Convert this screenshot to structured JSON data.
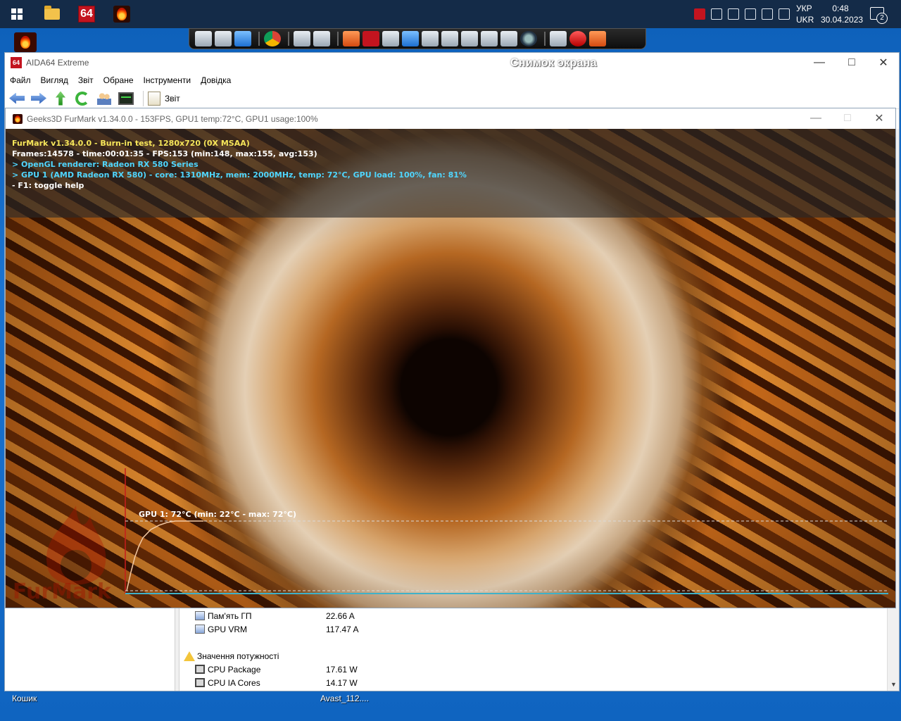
{
  "taskbar": {
    "lang_short": "УКР",
    "lang_code": "UKR",
    "time": "0:48",
    "date": "30.04.2023",
    "notifications": "2",
    "aida_label": "64"
  },
  "desktop": {
    "icons": [
      {
        "label": "Кошик"
      },
      {
        "label": "Avast_112...."
      }
    ]
  },
  "aida": {
    "title": "AIDA64 Extreme",
    "snip_label": "Снимок экрана",
    "menu": [
      "Файл",
      "Вигляд",
      "Звіт",
      "Обране",
      "Інструменти",
      "Довідка"
    ],
    "toolbar_report": "Звіт",
    "rows": [
      {
        "name": "Пам'ять ГП",
        "value": "22.66 A"
      },
      {
        "name": "GPU VRM",
        "value": "117.47 A"
      },
      {
        "section": "Значення потужності"
      },
      {
        "name": "CPU Package",
        "value": "17.61 W"
      },
      {
        "name": "CPU IA Cores",
        "value": "14.17 W"
      }
    ]
  },
  "furmark": {
    "title": "Geeks3D FurMark v1.34.0.0 - 153FPS, GPU1 temp:72°C, GPU1 usage:100%",
    "hud": [
      "FurMark v1.34.0.0 - Burn-in test, 1280x720 (0X MSAA)",
      "Frames:14578 - time:00:01:35 - FPS:153 (min:148, max:155, avg:153)",
      "> OpenGL renderer: Radeon RX 580 Series",
      "> GPU 1 (AMD Radeon RX 580) - core: 1310MHz, mem: 2000MHz, temp: 72°C, GPU load: 100%, fan: 81%",
      "- F1: toggle help"
    ],
    "graph_label": "GPU 1: 72°C (min: 22°C - max: 72°C)",
    "logo_text": "FurMark"
  },
  "chart_data": {
    "type": "line",
    "title": "GPU 1: 72°C (min: 22°C - max: 72°C)",
    "series": [
      {
        "name": "GPU 1",
        "x": [
          0,
          5,
          10,
          15,
          20,
          30,
          40,
          50,
          60,
          70,
          80,
          90,
          95
        ],
        "values": [
          22,
          35,
          46,
          54,
          60,
          66,
          69,
          71,
          72,
          72,
          72,
          72,
          72
        ]
      }
    ],
    "ylim": [
      0,
      100
    ],
    "xlabel": "",
    "ylabel": ""
  },
  "colors": {
    "hud_yellow": "#f6e65a",
    "hud_cyan": "#4fd6ff",
    "graph_line": "#f3c9a3",
    "graph_axis": "#c61d1d",
    "graph_baseline": "#3fb1c9"
  }
}
